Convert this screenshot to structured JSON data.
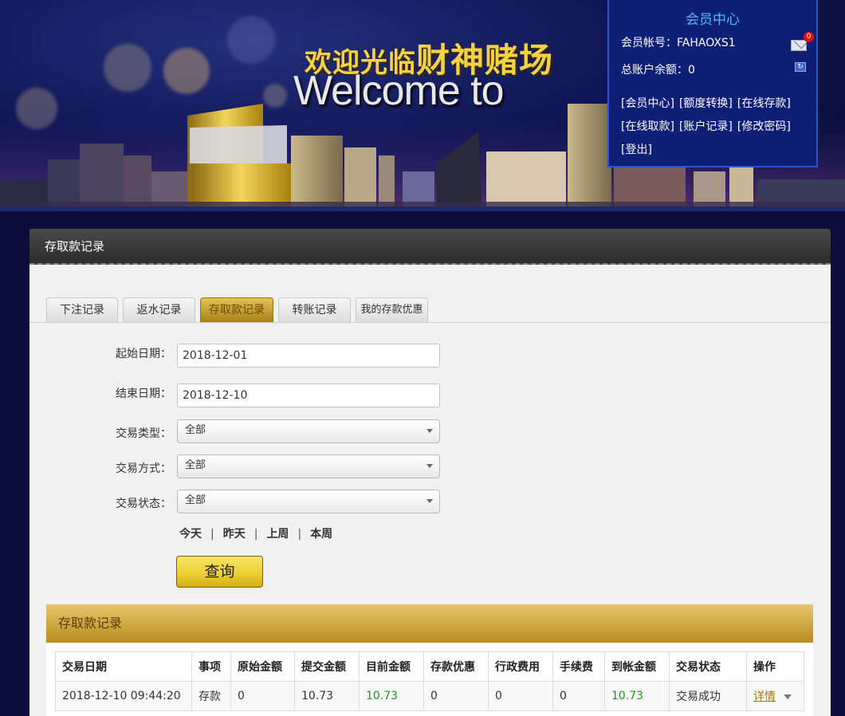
{
  "banner": {
    "welcome_cn_prefix": "欢迎光临",
    "welcome_cn_name": "财神赌场",
    "welcome_en": "Welcome to"
  },
  "member": {
    "title": "会员中心",
    "account_label": "会员帐号：",
    "account": "FAHAOXS1",
    "balance_label": "总账户余额：",
    "balance": "0",
    "unread_messages": "0",
    "links": [
      "[会员中心]",
      "[额度转换]",
      "[在线存款]",
      "[在线取款]",
      "[账户记录]",
      "[修改密码]",
      "[登出]"
    ]
  },
  "panel": {
    "title": "存取款记录",
    "tabs": [
      "下注记录",
      "返水记录",
      "存取款记录",
      "转账记录",
      "我的存款优惠"
    ],
    "active_tab": "存取款记录"
  },
  "form": {
    "start_label": "起始日期：",
    "start_value": "2018-12-01",
    "end_label": "结束日期：",
    "end_value": "2018-12-10",
    "type_label": "交易类型：",
    "type_value": "全部",
    "method_label": "交易方式：",
    "method_value": "全部",
    "status_label": "交易状态：",
    "status_value": "全部",
    "quick": [
      "今天",
      "昨天",
      "上周",
      "本周"
    ],
    "query_button": "查询"
  },
  "records": {
    "title": "存取款记录",
    "columns": [
      "交易日期",
      "事项",
      "原始金额",
      "提交金额",
      "目前金额",
      "存款优惠",
      "行政费用",
      "手续费",
      "到帐金额",
      "交易状态",
      "操作"
    ],
    "rows": [
      {
        "date": "2018-12-10 09:44:20",
        "item": "存款",
        "original": "0",
        "submitted": "10.73",
        "current": "10.73",
        "bonus": "0",
        "admin_fee": "0",
        "fee": "0",
        "received": "10.73",
        "status": "交易成功",
        "action": "详情"
      }
    ]
  },
  "colors": {
    "accent_gold": "#d3ad14",
    "member_title": "#4fb8ff",
    "amount_green": "#1a9a1a",
    "badge_red": "#e01010"
  }
}
